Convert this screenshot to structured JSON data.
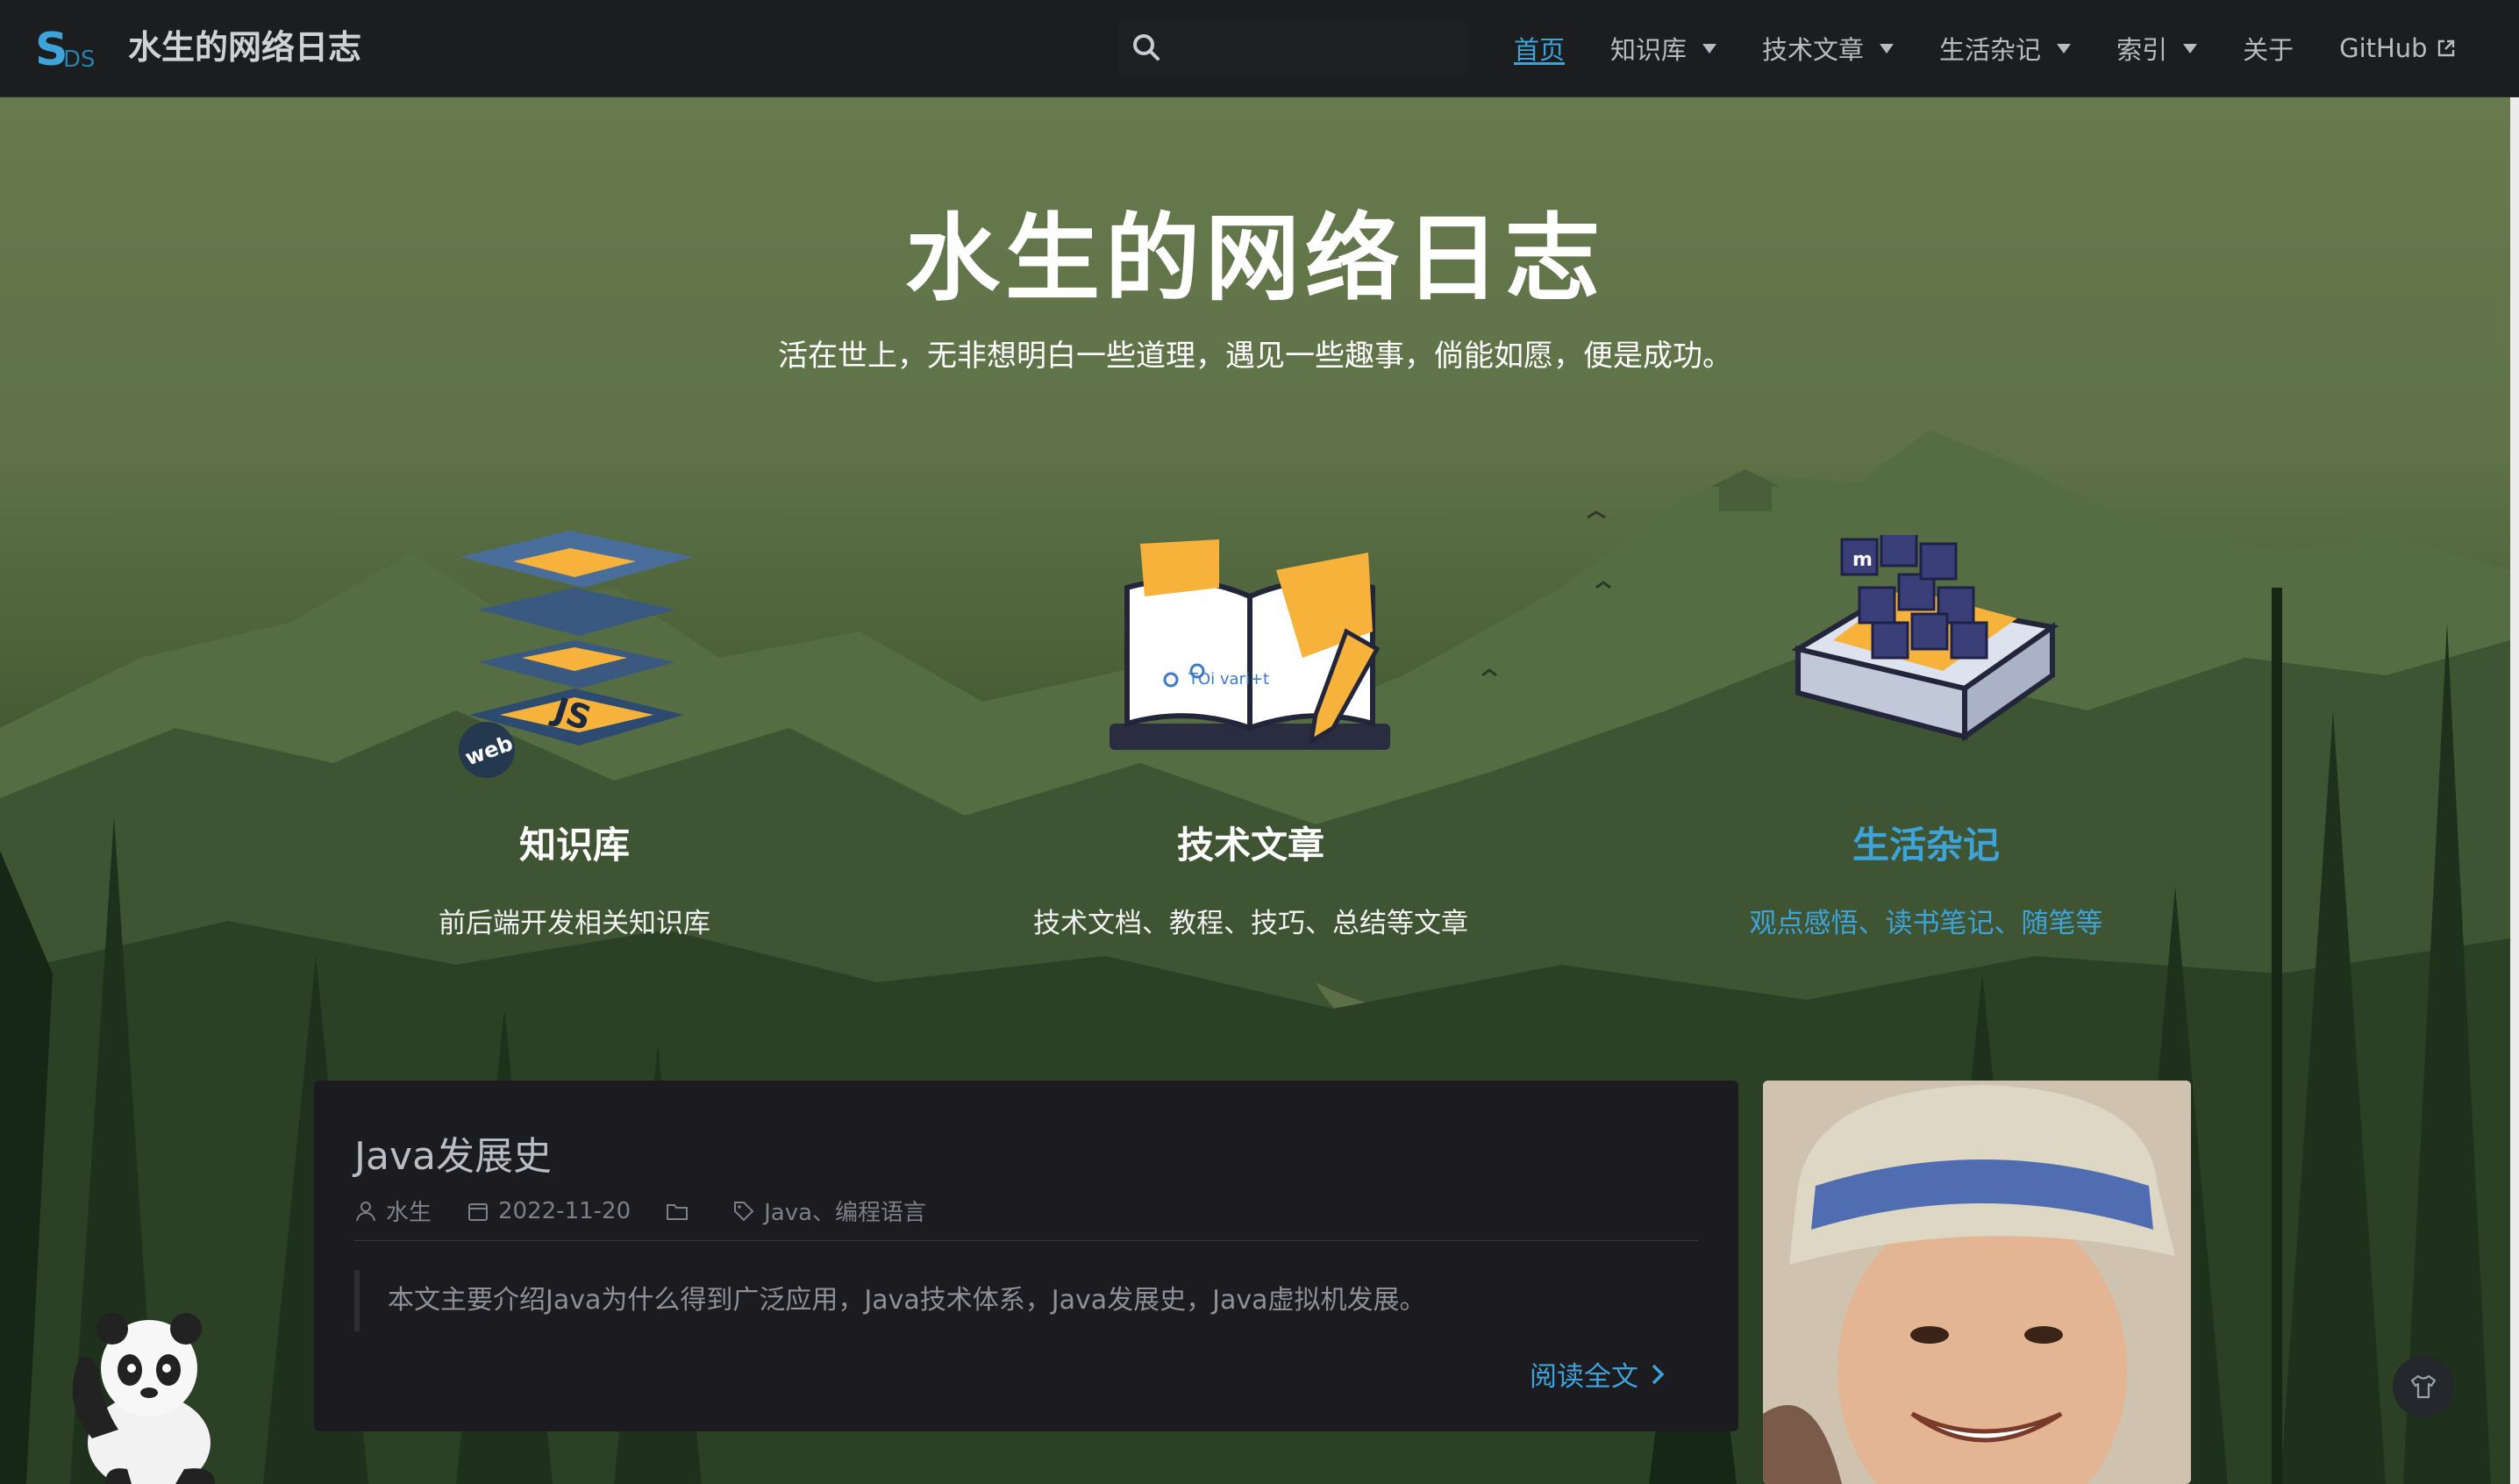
{
  "nav": {
    "logo_text": "SDS",
    "site_title": "水生的网络日志",
    "search_placeholder": "",
    "items": [
      {
        "label": "首页",
        "active": true,
        "dropdown": false
      },
      {
        "label": "知识库",
        "dropdown": true
      },
      {
        "label": "技术文章",
        "dropdown": true
      },
      {
        "label": "生活杂记",
        "dropdown": true
      },
      {
        "label": "索引",
        "dropdown": true
      },
      {
        "label": "关于",
        "dropdown": false
      },
      {
        "label": "GitHub",
        "external": true
      }
    ]
  },
  "hero": {
    "title": "水生的网络日志",
    "subtitle": "活在世上，无非想明白一些道理，遇见一些趣事，倘能如愿，便是成功。",
    "features": [
      {
        "title": "知识库",
        "desc": "前后端开发相关知识库",
        "icon": "web-js-stack-icon",
        "icon_text": "web"
      },
      {
        "title": "技术文章",
        "desc": "技术文档、教程、技巧、总结等文章",
        "icon": "book-pencil-icon",
        "icon_text": "TOi vari+t"
      },
      {
        "title": "生活杂记",
        "desc": "观点感悟、读书笔记、随笔等",
        "icon": "cube-tray-icon",
        "icon_text": "m",
        "highlighted": true
      }
    ]
  },
  "post": {
    "title": "Java发展史",
    "author": "水生",
    "date": "2022-11-20",
    "category": "",
    "tags": "Java、编程语言",
    "excerpt": "本文主要介绍Java为什么得到广泛应用，Java技术体系，Java发展史，Java虚拟机发展。",
    "read_more": "阅读全文"
  },
  "colors": {
    "accent": "#3ea3d9",
    "nav_bg": "#1b1d1f",
    "card_bg": "#1c1c20"
  }
}
